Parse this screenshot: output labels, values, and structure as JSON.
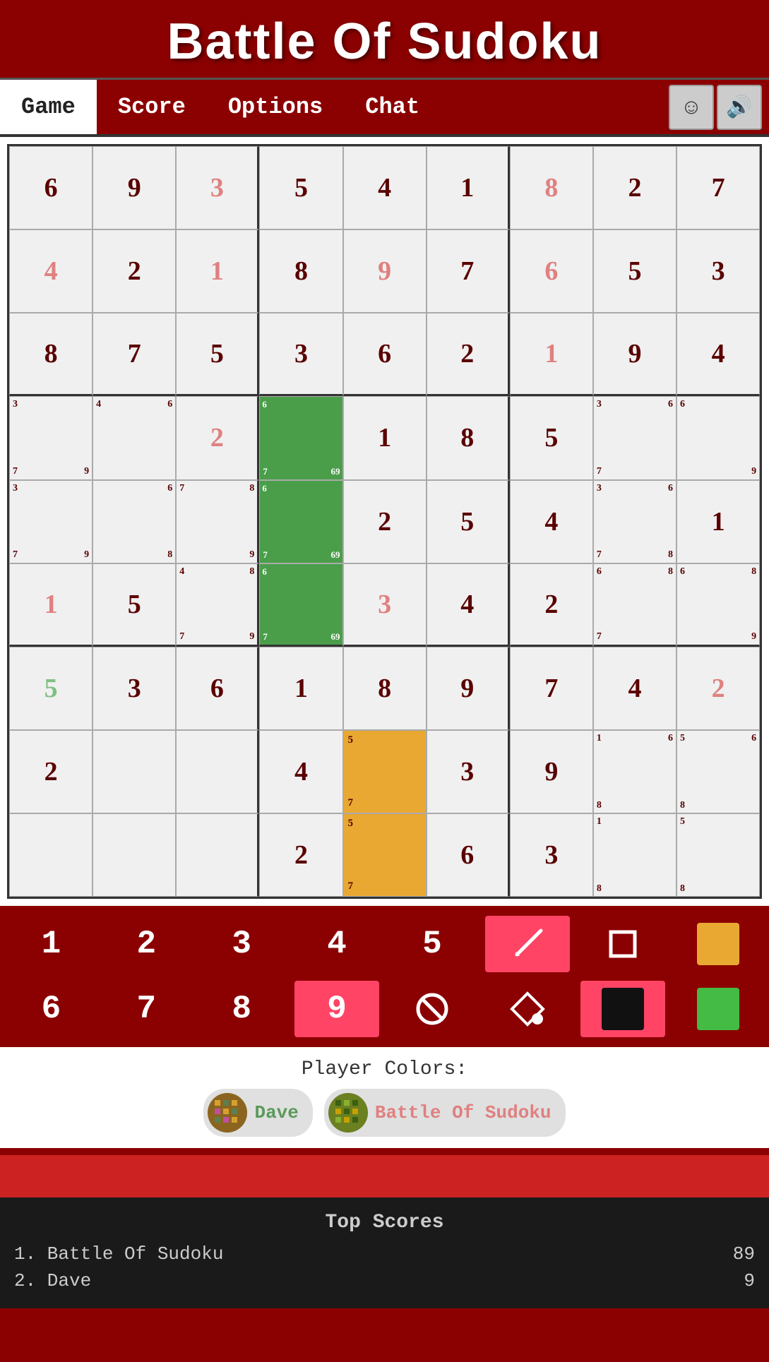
{
  "header": {
    "title": "Battle Of Sudoku"
  },
  "nav": {
    "tabs": [
      "Game",
      "Score",
      "Options",
      "Chat"
    ],
    "active_tab": "Game"
  },
  "grid": {
    "cells": [
      {
        "row": 0,
        "col": 0,
        "val": "6",
        "type": "fixed"
      },
      {
        "row": 0,
        "col": 1,
        "val": "9",
        "type": "fixed"
      },
      {
        "row": 0,
        "col": 2,
        "val": "3",
        "type": "player",
        "color": "pink"
      },
      {
        "row": 0,
        "col": 3,
        "val": "5",
        "type": "fixed"
      },
      {
        "row": 0,
        "col": 4,
        "val": "4",
        "type": "fixed"
      },
      {
        "row": 0,
        "col": 5,
        "val": "1",
        "type": "fixed"
      },
      {
        "row": 0,
        "col": 6,
        "val": "8",
        "type": "player",
        "color": "pink"
      },
      {
        "row": 0,
        "col": 7,
        "val": "2",
        "type": "fixed"
      },
      {
        "row": 0,
        "col": 8,
        "val": "7",
        "type": "fixed"
      },
      {
        "row": 1,
        "col": 0,
        "val": "4",
        "type": "player",
        "color": "pink"
      },
      {
        "row": 1,
        "col": 1,
        "val": "2",
        "type": "fixed"
      },
      {
        "row": 1,
        "col": 2,
        "val": "1",
        "type": "player",
        "color": "pink"
      },
      {
        "row": 1,
        "col": 3,
        "val": "8",
        "type": "fixed"
      },
      {
        "row": 1,
        "col": 4,
        "val": "9",
        "type": "player",
        "color": "pink"
      },
      {
        "row": 1,
        "col": 5,
        "val": "7",
        "type": "fixed"
      },
      {
        "row": 1,
        "col": 6,
        "val": "6",
        "type": "player",
        "color": "pink"
      },
      {
        "row": 1,
        "col": 7,
        "val": "5",
        "type": "fixed"
      },
      {
        "row": 1,
        "col": 8,
        "val": "3",
        "type": "fixed"
      },
      {
        "row": 2,
        "col": 0,
        "val": "8",
        "type": "fixed"
      },
      {
        "row": 2,
        "col": 1,
        "val": "7",
        "type": "fixed"
      },
      {
        "row": 2,
        "col": 2,
        "val": "5",
        "type": "fixed"
      },
      {
        "row": 2,
        "col": 3,
        "val": "3",
        "type": "fixed"
      },
      {
        "row": 2,
        "col": 4,
        "val": "6",
        "type": "fixed"
      },
      {
        "row": 2,
        "col": 5,
        "val": "2",
        "type": "fixed"
      },
      {
        "row": 2,
        "col": 6,
        "val": "1",
        "type": "player",
        "color": "pink"
      },
      {
        "row": 2,
        "col": 7,
        "val": "9",
        "type": "fixed"
      },
      {
        "row": 2,
        "col": 8,
        "val": "4",
        "type": "fixed"
      },
      {
        "row": 3,
        "col": 0,
        "val": "",
        "type": "notes",
        "notes_tl": "3",
        "notes_bl": "7",
        "notes_br": "9"
      },
      {
        "row": 3,
        "col": 1,
        "val": "",
        "type": "notes",
        "notes_tl": "4",
        "notes_tr": "6"
      },
      {
        "row": 3,
        "col": 2,
        "val": "2",
        "type": "player",
        "color": "pink"
      },
      {
        "row": 3,
        "col": 3,
        "val": "",
        "type": "green",
        "notes_bl": "7",
        "notes_br": "69",
        "notes_tl": "6",
        "notes_tr": ""
      },
      {
        "row": 3,
        "col": 4,
        "val": "1",
        "type": "fixed"
      },
      {
        "row": 3,
        "col": 5,
        "val": "8",
        "type": "fixed"
      },
      {
        "row": 3,
        "col": 6,
        "val": "5",
        "type": "fixed"
      },
      {
        "row": 3,
        "col": 7,
        "val": "",
        "type": "notes",
        "notes_tl": "3",
        "notes_bl": "7",
        "notes_tr": "6",
        "notes_br": ""
      },
      {
        "row": 3,
        "col": 8,
        "val": "",
        "type": "notes",
        "notes_tl": "6",
        "notes_br": "9"
      },
      {
        "row": 4,
        "col": 0,
        "val": "",
        "type": "notes",
        "notes_tl": "3",
        "notes_bl": "7",
        "notes_br": "9"
      },
      {
        "row": 4,
        "col": 1,
        "val": "",
        "type": "notes",
        "notes_tr": "6",
        "notes_br": "8"
      },
      {
        "row": 4,
        "col": 2,
        "val": "",
        "type": "notes",
        "notes_tl": "7",
        "notes_bl": "",
        "notes_tr": "8",
        "notes_br": "9"
      },
      {
        "row": 4,
        "col": 3,
        "val": "",
        "type": "green",
        "notes_bl": "7",
        "notes_br": "69",
        "notes_tl": "6"
      },
      {
        "row": 4,
        "col": 4,
        "val": "2",
        "type": "fixed"
      },
      {
        "row": 4,
        "col": 5,
        "val": "5",
        "type": "fixed"
      },
      {
        "row": 4,
        "col": 6,
        "val": "4",
        "type": "fixed"
      },
      {
        "row": 4,
        "col": 7,
        "val": "",
        "type": "notes",
        "notes_tl": "3",
        "notes_bl": "7",
        "notes_tr": "6",
        "notes_br": "8"
      },
      {
        "row": 4,
        "col": 8,
        "val": "1",
        "type": "fixed"
      },
      {
        "row": 5,
        "col": 0,
        "val": "1",
        "type": "player",
        "color": "pink"
      },
      {
        "row": 5,
        "col": 1,
        "val": "5",
        "type": "fixed"
      },
      {
        "row": 5,
        "col": 2,
        "val": "",
        "type": "notes",
        "notes_tl": "4",
        "notes_bl": "7",
        "notes_tr": "8",
        "notes_br": "9"
      },
      {
        "row": 5,
        "col": 3,
        "val": "",
        "type": "green",
        "notes_bl": "7",
        "notes_br": "69",
        "notes_tl": "6"
      },
      {
        "row": 5,
        "col": 4,
        "val": "3",
        "type": "player",
        "color": "pink"
      },
      {
        "row": 5,
        "col": 5,
        "val": "4",
        "type": "fixed"
      },
      {
        "row": 5,
        "col": 6,
        "val": "2",
        "type": "fixed"
      },
      {
        "row": 5,
        "col": 7,
        "val": "",
        "type": "notes",
        "notes_tl": "6",
        "notes_bl": "7",
        "notes_tr": "8"
      },
      {
        "row": 5,
        "col": 8,
        "val": "",
        "type": "notes",
        "notes_tl": "6",
        "notes_tr": "8",
        "notes_br": "9"
      },
      {
        "row": 6,
        "col": 0,
        "val": "5",
        "type": "player",
        "color": "lightgreen"
      },
      {
        "row": 6,
        "col": 1,
        "val": "3",
        "type": "fixed"
      },
      {
        "row": 6,
        "col": 2,
        "val": "6",
        "type": "fixed"
      },
      {
        "row": 6,
        "col": 3,
        "val": "1",
        "type": "fixed"
      },
      {
        "row": 6,
        "col": 4,
        "val": "8",
        "type": "fixed"
      },
      {
        "row": 6,
        "col": 5,
        "val": "9",
        "type": "fixed"
      },
      {
        "row": 6,
        "col": 6,
        "val": "7",
        "type": "fixed"
      },
      {
        "row": 6,
        "col": 7,
        "val": "4",
        "type": "fixed"
      },
      {
        "row": 6,
        "col": 8,
        "val": "2",
        "type": "player",
        "color": "pink"
      },
      {
        "row": 7,
        "col": 0,
        "val": "2",
        "type": "fixed"
      },
      {
        "row": 7,
        "col": 1,
        "val": "",
        "type": "empty"
      },
      {
        "row": 7,
        "col": 2,
        "val": "",
        "type": "empty"
      },
      {
        "row": 7,
        "col": 3,
        "val": "4",
        "type": "fixed"
      },
      {
        "row": 7,
        "col": 4,
        "val": "",
        "type": "orange",
        "notes_tl": "5",
        "notes_bl": "7"
      },
      {
        "row": 7,
        "col": 5,
        "val": "3",
        "type": "fixed"
      },
      {
        "row": 7,
        "col": 6,
        "val": "9",
        "type": "fixed"
      },
      {
        "row": 7,
        "col": 7,
        "val": "",
        "type": "notes",
        "notes_tl": "1",
        "notes_bl": "8",
        "notes_tr": "6"
      },
      {
        "row": 7,
        "col": 8,
        "val": "",
        "type": "notes",
        "notes_tl": "5",
        "notes_bl": "8",
        "notes_tr": "6"
      },
      {
        "row": 8,
        "col": 0,
        "val": "",
        "type": "empty"
      },
      {
        "row": 8,
        "col": 1,
        "val": "",
        "type": "empty"
      },
      {
        "row": 8,
        "col": 2,
        "val": "",
        "type": "empty"
      },
      {
        "row": 8,
        "col": 3,
        "val": "2",
        "type": "fixed"
      },
      {
        "row": 8,
        "col": 4,
        "val": "",
        "type": "orange",
        "notes_tl": "5",
        "notes_bl": "7"
      },
      {
        "row": 8,
        "col": 5,
        "val": "6",
        "type": "fixed"
      },
      {
        "row": 8,
        "col": 6,
        "val": "3",
        "type": "fixed"
      },
      {
        "row": 8,
        "col": 7,
        "val": "",
        "type": "notes",
        "notes_tl": "1",
        "notes_bl": "8"
      },
      {
        "row": 8,
        "col": 8,
        "val": "",
        "type": "notes",
        "notes_tl": "5",
        "notes_bl": "8"
      }
    ]
  },
  "input_row1": {
    "buttons": [
      "1",
      "2",
      "3",
      "4",
      "5"
    ],
    "tools": [
      "pencil",
      "square",
      "orange-square"
    ]
  },
  "input_row2": {
    "buttons": [
      "6",
      "7",
      "8",
      "9"
    ],
    "tools": [
      "ban",
      "diamond-fill",
      "black-square",
      "green-square"
    ]
  },
  "player_colors": {
    "label": "Player Colors:",
    "players": [
      {
        "name": "Dave",
        "color": "green"
      },
      {
        "name": "Battle Of Sudoku",
        "color": "pink"
      }
    ]
  },
  "top_scores": {
    "title": "Top Scores",
    "entries": [
      {
        "rank": "1.",
        "name": "Battle Of Sudoku",
        "score": "89"
      },
      {
        "rank": "2.",
        "name": "Dave",
        "score": "9"
      }
    ]
  }
}
